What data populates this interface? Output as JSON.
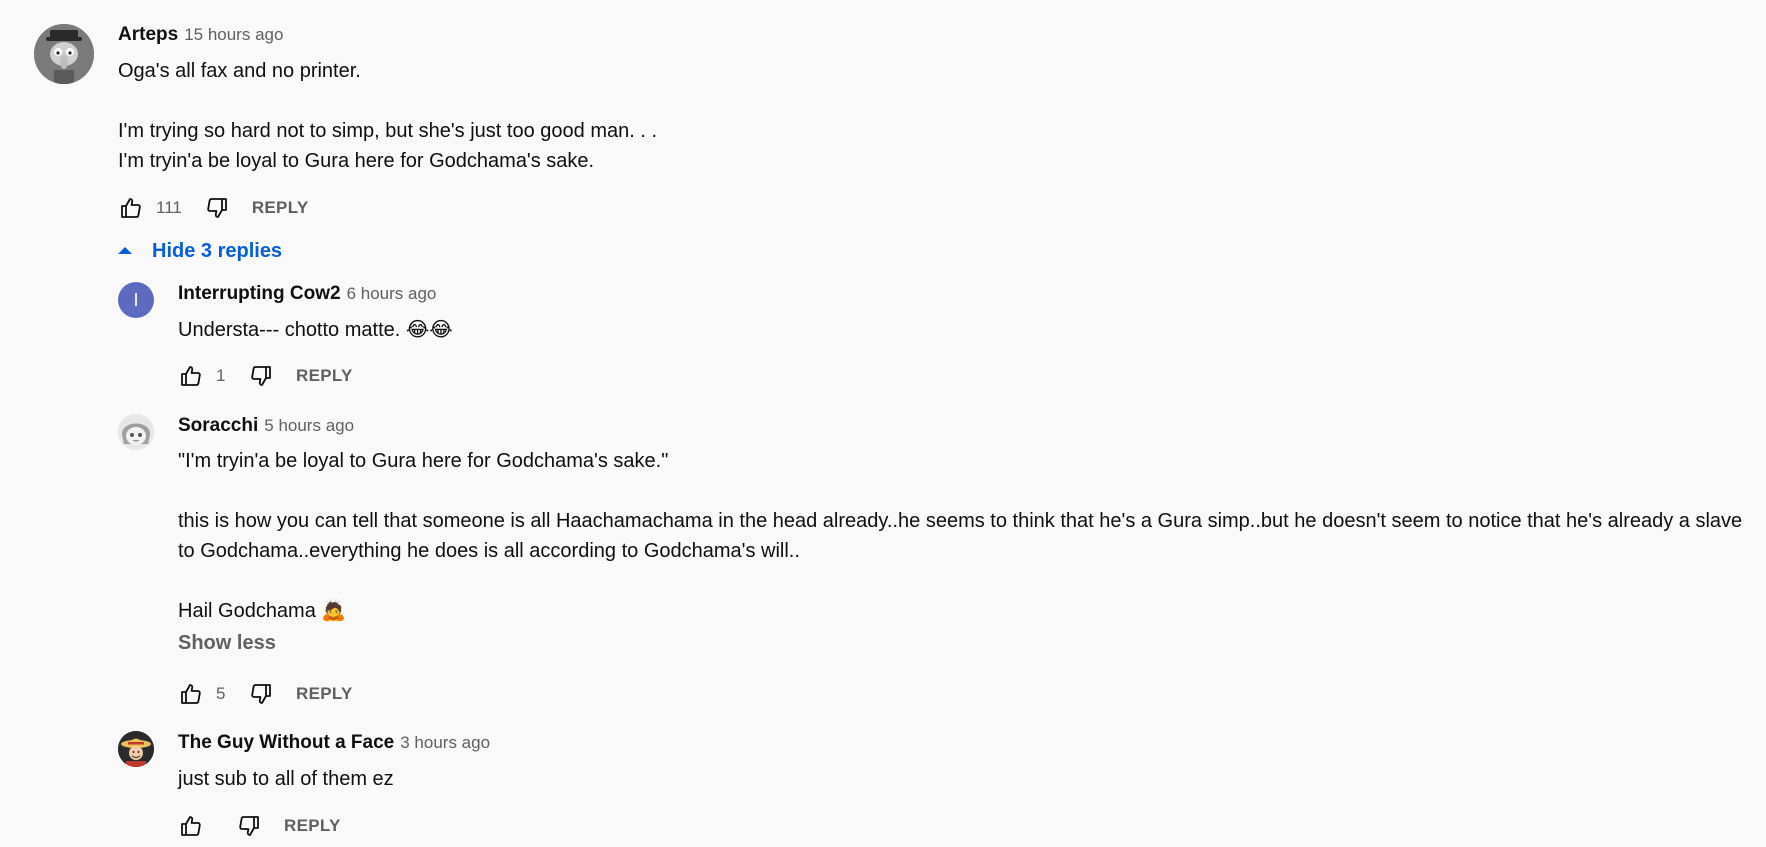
{
  "comment": {
    "author": "Arteps",
    "time": "15 hours ago",
    "text": "Oga's all fax and no printer.\n\nI'm trying so hard not to simp, but she's just too good man. . .\nI'm tryin'a be loyal to Gura here for Godchama's sake.",
    "likes": "111",
    "reply_label": "REPLY",
    "avatar_icon": "squidward-avatar"
  },
  "replies_toggle": {
    "label": "Hide 3 replies",
    "icon": "caret-up-icon",
    "color": "#065fd4"
  },
  "replies": [
    {
      "author": "Interrupting Cow2",
      "time": "6 hours ago",
      "text": "Understa--- chotto matte. 😂😂",
      "likes": "1",
      "reply_label": "REPLY",
      "avatar_letter": "I",
      "avatar_color": "#5c6bc0"
    },
    {
      "author": "Soracchi",
      "time": "5 hours ago",
      "text": "\"I'm tryin'a be loyal to Gura here for Godchama's sake.\"\n\nthis is how you can tell that someone is all Haachamachama in the head already..he seems to think that he's a Gura simp..but he doesn't seem to notice that he's already a slave to Godchama..everything he does is all according to Godchama's will..\n\nHail Godchama 🙇",
      "show_less_label": "Show less",
      "likes": "5",
      "reply_label": "REPLY",
      "avatar_icon": "anime-avatar"
    },
    {
      "author": "The Guy Without a Face",
      "time": "3 hours ago",
      "text": "just sub to all of them ez",
      "likes": "",
      "reply_label": "REPLY",
      "avatar_icon": "straw-hat-avatar"
    }
  ]
}
